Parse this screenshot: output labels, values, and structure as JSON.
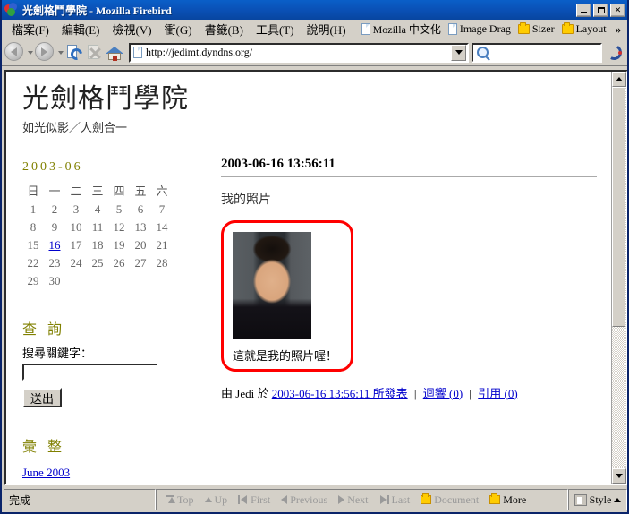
{
  "window": {
    "title": "光劍格鬥學院 - Mozilla Firebird",
    "minimize_label": "_",
    "maximize_label": "□",
    "close_label": "✕"
  },
  "menubar": {
    "items": [
      {
        "label": "檔案(F)"
      },
      {
        "label": "編輯(E)"
      },
      {
        "label": "檢視(V)"
      },
      {
        "label": "衝(G)"
      },
      {
        "label": "書籤(B)"
      },
      {
        "label": "工具(T)"
      },
      {
        "label": "說明(H)"
      }
    ],
    "bookmarks": [
      {
        "label": "Mozilla 中文化",
        "icon": "document-icon"
      },
      {
        "label": "Image Drag",
        "icon": "document-icon"
      },
      {
        "label": "Sizer",
        "icon": "folder-icon"
      },
      {
        "label": "Layout",
        "icon": "folder-icon"
      }
    ],
    "overflow_label": "»"
  },
  "toolbar": {
    "back_icon": "back-arrow-icon",
    "forward_icon": "forward-arrow-icon",
    "reload_icon": "reload-icon",
    "stop_icon": "stop-icon",
    "home_icon": "home-icon",
    "url_value": "http://jedimt.dyndns.org/",
    "url_placeholder": "",
    "search_value": "",
    "search_placeholder": "",
    "search_icon": "magnifier-icon",
    "brand_icon": "firebird-logo-icon"
  },
  "site": {
    "title": "光劍格鬥學院",
    "tagline": "如光似影／人劍合一"
  },
  "sidebar": {
    "calendar": {
      "title": "2003-06",
      "weekdays": [
        "日",
        "一",
        "二",
        "三",
        "四",
        "五",
        "六"
      ],
      "weeks": [
        [
          "1",
          "2",
          "3",
          "4",
          "5",
          "6",
          "7"
        ],
        [
          "8",
          "9",
          "10",
          "11",
          "12",
          "13",
          "14"
        ],
        [
          "15",
          "16",
          "17",
          "18",
          "19",
          "20",
          "21"
        ],
        [
          "22",
          "23",
          "24",
          "25",
          "26",
          "27",
          "28"
        ],
        [
          "29",
          "30",
          "",
          "",
          "",
          "",
          ""
        ]
      ],
      "linked_day": "16"
    },
    "search": {
      "heading": "查 詢",
      "label": "搜尋關鍵字：",
      "value": "",
      "placeholder": "",
      "button_label": "送出"
    },
    "archive": {
      "heading": "彙 整",
      "items": [
        {
          "label": "June 2003"
        }
      ]
    }
  },
  "entry": {
    "date_heading": "2003-06-16 13:56:11",
    "title": "我的照片",
    "photo_caption": "這就是我的照片喔！",
    "footer": {
      "by_prefix": "由",
      "author": "Jedi",
      "at_word": "於",
      "date_link": "2003-06-16 13:56:11 所發表",
      "separator": "|",
      "comments_link": "迴響 (0)",
      "trackback_link": "引用 (0)"
    }
  },
  "statusbar": {
    "status_text": "完成",
    "nav_items": [
      {
        "label": "Top",
        "icon": "top-arrow-icon",
        "enabled": false
      },
      {
        "label": "Up",
        "icon": "up-arrow-icon",
        "enabled": false
      },
      {
        "label": "First",
        "icon": "first-arrow-icon",
        "enabled": false
      },
      {
        "label": "Previous",
        "icon": "previous-arrow-icon",
        "enabled": false
      },
      {
        "label": "Next",
        "icon": "next-arrow-icon",
        "enabled": false
      },
      {
        "label": "Last",
        "icon": "last-arrow-icon",
        "enabled": false
      },
      {
        "label": "Document",
        "icon": "folder-icon",
        "enabled": false
      },
      {
        "label": "More",
        "icon": "folder-icon",
        "enabled": true
      }
    ],
    "style_label": "Style",
    "style_icon": "style-icon"
  },
  "colors": {
    "titlebar": "#0a52b8",
    "chrome": "#d4d0c8",
    "link": "#0000cc",
    "heading_olive": "#808000",
    "photo_border": "#ff0000"
  }
}
